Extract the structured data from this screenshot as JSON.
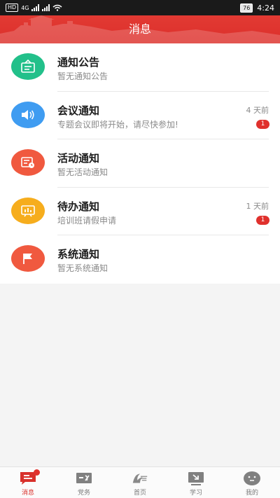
{
  "statusbar": {
    "network": "4G",
    "hd": "HD",
    "battery": "76",
    "time": "4:24"
  },
  "header": {
    "title": "消息"
  },
  "messages": [
    {
      "title": "通知公告",
      "subtitle": "暂无通知公告",
      "time": "",
      "badge": "",
      "icon": "notice-board-icon",
      "color": "#22c08a"
    },
    {
      "title": "会议通知",
      "subtitle": "专题会议即将开始，请尽快参加!",
      "time": "4 天前",
      "badge": "1",
      "icon": "speaker-icon",
      "color": "#3f9cf1"
    },
    {
      "title": "活动通知",
      "subtitle": "暂无活动通知",
      "time": "",
      "badge": "",
      "icon": "calendar-card-icon",
      "color": "#f0593f"
    },
    {
      "title": "待办通知",
      "subtitle": "培训班请假申请",
      "time": "1 天前",
      "badge": "1",
      "icon": "chart-board-icon",
      "color": "#f6ad1d"
    },
    {
      "title": "系统通知",
      "subtitle": "暂无系统通知",
      "time": "",
      "badge": "",
      "icon": "flag-icon",
      "color": "#f0593f"
    }
  ],
  "tabs": [
    {
      "label": "消息",
      "icon": "message-icon",
      "active": true
    },
    {
      "label": "党务",
      "icon": "party-affairs-icon",
      "active": false
    },
    {
      "label": "首页",
      "icon": "home-logo-icon",
      "active": false
    },
    {
      "label": "学习",
      "icon": "study-icon",
      "active": false
    },
    {
      "label": "我的",
      "icon": "profile-face-icon",
      "active": false
    }
  ],
  "colors": {
    "primary": "#dc2f2b",
    "badge": "#e0312d",
    "tab_inactive": "#7a7a7a"
  }
}
